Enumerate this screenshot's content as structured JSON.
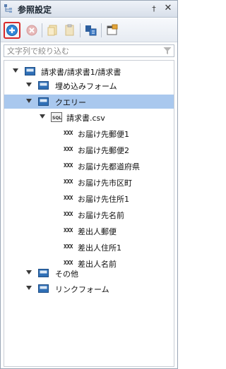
{
  "panel": {
    "title": "参照設定"
  },
  "search": {
    "placeholder": "文字列で絞り込む",
    "value": ""
  },
  "tree": {
    "root": {
      "label": "請求書/請求書1/請求書"
    },
    "embedded_form": {
      "label": "埋め込みフォーム"
    },
    "query": {
      "label": "クエリー"
    },
    "csv": {
      "label": "請求書.csv"
    },
    "fields": [
      {
        "badge": "XXX",
        "label": "お届け先郵便1"
      },
      {
        "badge": "XXX",
        "label": "お届け先郵便2"
      },
      {
        "badge": "XXX",
        "label": "お届け先都道府県"
      },
      {
        "badge": "XXX",
        "label": "お届け先市区町"
      },
      {
        "badge": "XXX",
        "label": "お届け先住所1"
      },
      {
        "badge": "XXX",
        "label": "お届け先名前"
      },
      {
        "badge": "XXX",
        "label": "差出人郵便"
      },
      {
        "badge": "XXX",
        "label": "差出人住所1"
      },
      {
        "badge": "XXX",
        "label": "差出人名前"
      }
    ],
    "other": {
      "label": "その他"
    },
    "link_form": {
      "label": "リンクフォーム"
    }
  },
  "colors": {
    "selection": "#a9c8ee",
    "active_outline": "#d92a2a",
    "folder_blue": "#2f6fb6"
  }
}
